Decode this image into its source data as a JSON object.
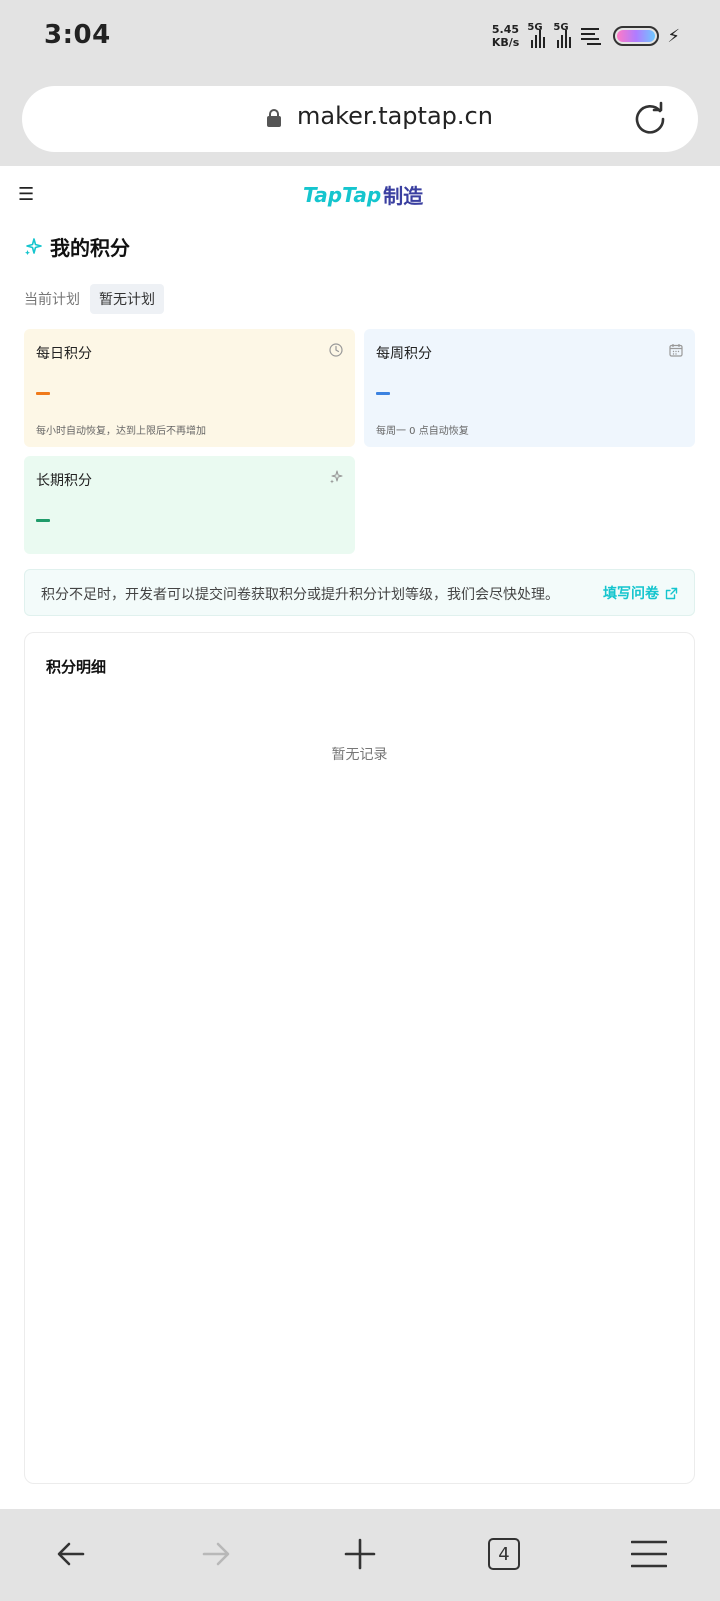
{
  "status_bar": {
    "time": "3:04",
    "net_speed_value": "5.45",
    "net_speed_unit": "KB/s",
    "signal_1_label": "5G",
    "signal_2_label": "5G",
    "battery_colors": [
      "#ff79c6",
      "#b07cff",
      "#6ec8ff"
    ]
  },
  "browser": {
    "url": "maker.taptap.cn",
    "open_tabs_count": "4"
  },
  "header": {
    "logo_brand": "TapTap",
    "logo_suffix": "制造"
  },
  "page": {
    "title": "我的积分",
    "plan_label": "当前计划",
    "plan_value": "暂无计划"
  },
  "cards": {
    "daily": {
      "title": "每日积分",
      "note": "每小时自动恢复，达到上限后不再增加",
      "accent": "#f07a1a",
      "icon": "clock-icon"
    },
    "weekly": {
      "title": "每周积分",
      "note": "每周一 0 点自动恢复",
      "accent": "#3b82e0",
      "icon": "calendar-icon"
    },
    "long_term": {
      "title": "长期积分",
      "accent": "#1f9b6a",
      "icon": "sparkle-icon"
    }
  },
  "notice": {
    "text": "积分不足时，开发者可以提交问卷获取积分或提升积分计划等级，我们会尽快处理。",
    "link_label": "填写问卷"
  },
  "detail": {
    "title": "积分明细",
    "empty_text": "暂无记录"
  },
  "colors": {
    "brand": "#15c5ce",
    "brand_secondary": "#3a3fa0"
  }
}
